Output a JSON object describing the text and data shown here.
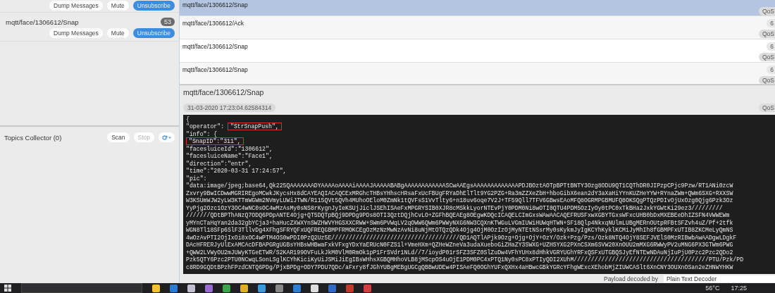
{
  "subscriptions": {
    "previous_buttons": [
      {
        "label": "Dump Messages",
        "kind": "plain"
      },
      {
        "label": "Mute",
        "kind": "plain"
      },
      {
        "label": "Unsubscribe",
        "kind": "primary"
      }
    ],
    "subscription": {
      "topic": "mqtt/face/1306612/Snap",
      "count": "53",
      "buttons": [
        {
          "label": "Dump Messages",
          "kind": "plain"
        },
        {
          "label": "Mute",
          "kind": "plain"
        },
        {
          "label": "Unsubscribe",
          "kind": "primary"
        }
      ]
    }
  },
  "topics_collector": {
    "title": "Topics Collector (0)",
    "buttons": [
      {
        "label": "Scan",
        "disabled": false
      },
      {
        "label": "Stop",
        "disabled": true
      }
    ]
  },
  "messages": [
    {
      "topic": "mqtt/face/1306612/Snap",
      "qos": "QoS",
      "selected": true
    },
    {
      "topic": "mqtt/face/1306612/Ack",
      "count": "6",
      "qos": "QoS",
      "selected": false
    },
    {
      "topic": "mqtt/face/1306612/Snap",
      "count": "6",
      "qos": "QoS",
      "selected": false
    },
    {
      "topic": "mqtt/face/1306612/Snap",
      "count": "6",
      "qos": "QoS",
      "selected": false
    }
  ],
  "detail": {
    "topic": "mqtt/face/1306612/Snap",
    "timestamp": "31-03-2020 17:23:04.62584314",
    "qos": "QoS",
    "payload_lines": [
      [
        {
          "text": "{",
          "boxed": false
        }
      ],
      [
        {
          "text": "\"operator\": ",
          "boxed": false
        },
        {
          "text": "\"StrSnapPush\",",
          "boxed": true
        }
      ],
      [
        {
          "text": "\"info\": {",
          "boxed": false
        }
      ],
      [
        {
          "text": "\"SnapID\":\"311\",",
          "boxed": true
        }
      ],
      [
        {
          "text": "\"facesluiceId\":\"1306612\",",
          "boxed": false
        }
      ],
      [
        {
          "text": "\"facesluiceName\":\"Face1\",",
          "boxed": false
        }
      ],
      [
        {
          "text": "\"direction\":\"entr\",",
          "boxed": false
        }
      ],
      [
        {
          "text": "\"time\":\"2020-03-31 17:24:57\",",
          "boxed": false
        }
      ],
      [
        {
          "text": "\"pic\":",
          "boxed": false
        }
      ],
      [
        {
          "text": "\"data:image/jpeg;base64,Qk225QAAAAAAADYAAAAoAAAAiAAAAJAAAAABABgAAAAAAAAAAAASCwAAEgsAAAAAAAAAAAAAPDJBOztAOTpBPTtBNTY3Ozg8ODU9QT1CQThDR0JIPzpCPjc9Pzw/RT1ANi0zcW",
          "boxed": false
        }
      ],
      [
        {
          "text": "Zxvry9BwICDwwMGRIREgoMCwkJKycsHx8dCAYEAQIACAQCExMRGhcTHBsYHhscHRsaFxUcFBUgFRYaDhElTlt9YG2PZG+Ra3mZZXeZbH+hboGibX6ean2dY3aXaHiYYnKUZHeYYW+RYnaZWm+QWm6SXG+RXXSW",
          "boxed": false
        }
      ],
      [
        {
          "text": "W3KSUmWJW2yLW3KTTmWGWm2NVmyLUWiJTWN/R115QVt5QVh4MUhoOEloM0ZmNk1tQVFsS1VvTlty6+n18uv6oqe7V2J+TF59Qll7TFV6GBwsEAoMFQ8OGRMPGBMUFQ8OKSQgPTQzPDIvOjUxOzg0Qjg6Pzk3Oz",
          "boxed": false
        }
      ],
      [
        {
          "text": "YyPjg2Ozc1OzY3OC4wNC0sOC4wMzAsMy0sNS8rKygnJyIeKSUjJiclJSEhISAeFxMPGRYSIB0XJR8cMSkkLyorNTEvPjY0PDM0Ni8wOTI0QTU4PDM5OzIyOy0tPC0xTkBHa2JxkYGWtKi29ez3/////////",
          "boxed": false
        }
      ],
      [
        {
          "text": "///////QDtBPThANzQ7ODQ6PDpANTE4Ojg+QT5DQTpBQj9DPDg9PDs8OTI3QztDQjhCvLO+ZGFhBQEAEg8OEgwKDQcICAQELCImGxsWAwAACAQEFRUSFxwXGBYTGxsWFxcUHB0bDxMXEBEeDhIZSFN4VWWEWm",
          "boxed": false
        }
      ],
      [
        {
          "text": "yMYnCTaHqYan2da32gbYCja3+haHucZXWXYnSWZHWVYHGSXXCRWW+SWm6PVWqLV2qOWW6QWm6PWWyNXG6NW3CQXnKTWGuLVGmIUWiHUWqHTWN+SF18Qlp4NkxqNUlmLUBgMERnOUtpRFBtSFZvh4uZ/Pf+2tfk",
          "boxed": false
        }
      ],
      [
        {
          "text": "WGN8Tl18SFp6SlF3TllvDg4XFhgSFRYQFxUQFREQGBMPFRMOKCEgOzMzNzMwNzAvNi8uNjMtOTQzQDk4Ojg4OjM0OzIzOjMyNTEtNSsrMy0sKykmJyIgKCYhKyklKCMiJyMhIh8fGBMPFxUTIB8ZKCMeLyQmNS",
          "boxed": false
        }
      ],
      [
        {
          "text": "4wOzAvPTI2OjIxOi8xOC4wPTM4OS0wPDI0PzQ2Uz5E/////////////////////////////////////QD1AQTlAPjk9Ozg+Ojg+OjY+OzY/Ozk+Pzg/Pzs/Ozk8NTQ4OjY8SEFJVElS0MzRIBwbAwAADgwLDgkF",
          "boxed": false
        }
      ],
      [
        {
          "text": "DAcHFRERJyUlExAMCAcDFBAPGRgUGBsYHBsWHBwaFxkVFxgYDxYaERUcN0FZS1l+VmeHXm+QZHeWZneVa3udaXueboGiZHaZY3SWXG+UZHSYXG2PXnCSXm6SVW20XnOUU2mMXG6RWWyPV2uMNG6PX3GTWm6PWG",
          "boxed": false
        }
      ],
      [
        {
          "text": "+QWW2LVWyOU2mJUWyKTGeETWR/S2KAR199OVFuLkJkM0VlM0RmOk1pP1FrSVdr1NLd//7/ioydP01rSFZ3SFZ0SlZuDw4VFhYUHx8dHhkVGRYUGhYRFxQSFxUTGBQSJyEfNTEwNDAuNjIuPjU0Pzc2Pzc2QDo2",
          "boxed": false
        }
      ],
      [
        {
          "text": "Pzk5QTY6Pzc2PTU0NCwqLSonLSglKCYhKiciKyUiJSMiJiEgIBsWHhsXGBQMHhoVLB8jMScpOS4uOjE1PDM0PC4xPTQ1Ny0sPC8xPTIyQDI2XUhM///////////////////////////////////////PTU/Pzk/PD",
          "boxed": false
        }
      ],
      [
        {
          "text": "c8RD9GQDtBPzhFPzdCNTQ6PDg/PjxBPDg+ODY7PDU7QDc/aFxry8fJGhYUBgMEBgUGCgQBBwUDEw4PISAeFQ0OGhYUFxQXHx4aHBwcGBkYGRcYFhgWExcXEhobMjZIUWCASlt6XnCNY3OUXnOSan2eZHNWYHKW",
          "boxed": false
        }
      ]
    ],
    "decoder_label": "Payload decoded by",
    "decoder": "Plain Text Decoder"
  },
  "taskbar": {
    "temperature": "56°C",
    "clock": "17:25"
  }
}
